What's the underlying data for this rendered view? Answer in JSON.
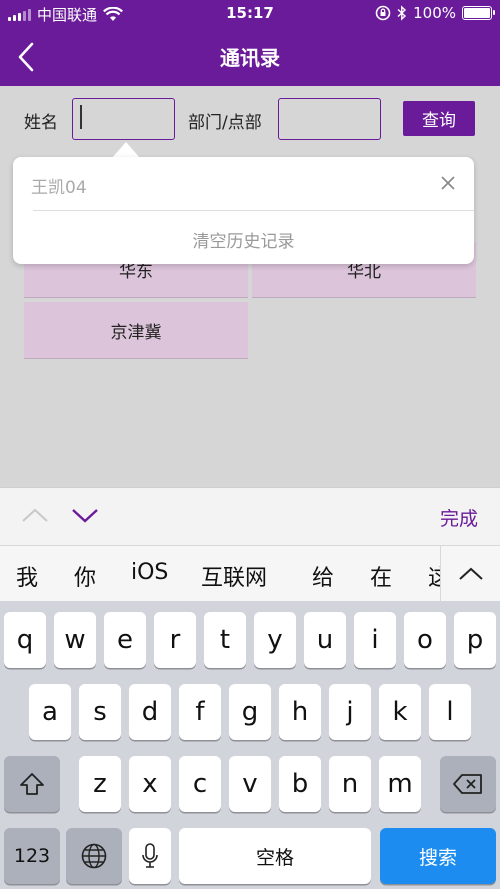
{
  "status": {
    "carrier": "中国联通",
    "time": "15:17",
    "battery": "100%",
    "battery_level": 1.0
  },
  "nav": {
    "title": "通讯录"
  },
  "search": {
    "name_label": "姓名",
    "name_value": "",
    "dept_label": "部门/点部",
    "dept_value": "",
    "query_button": "查询"
  },
  "regions": [
    {
      "label": "华东"
    },
    {
      "label": "华北"
    },
    {
      "label": "京津冀"
    }
  ],
  "history": {
    "item": "王凯04",
    "clear_label": "清空历史记录"
  },
  "keyboard_toolbar": {
    "done_label": "完成"
  },
  "suggestions": [
    "我",
    "你",
    "iOS",
    "互联网",
    "给",
    "在",
    "这"
  ],
  "keyboard": {
    "row1": [
      "q",
      "w",
      "e",
      "r",
      "t",
      "y",
      "u",
      "i",
      "o",
      "p"
    ],
    "row2": [
      "a",
      "s",
      "d",
      "f",
      "g",
      "h",
      "j",
      "k",
      "l"
    ],
    "row3": [
      "z",
      "x",
      "c",
      "v",
      "b",
      "n",
      "m"
    ],
    "numbers_key": "123",
    "space_key": "空格",
    "search_key": "搜索"
  },
  "colors": {
    "brand": "#6a1b9a",
    "cell_bg": "#dcc4da",
    "search_key": "#1d8cf0"
  },
  "icons": {
    "back": "chevron-left-icon",
    "wifi": "wifi-icon",
    "bluetooth": "bluetooth-icon",
    "lock_rotation": "rotation-lock-icon",
    "close": "close-icon",
    "shift": "shift-icon",
    "globe": "globe-icon",
    "mic": "microphone-icon",
    "delete": "backspace-icon",
    "expand": "chevron-up-icon"
  }
}
